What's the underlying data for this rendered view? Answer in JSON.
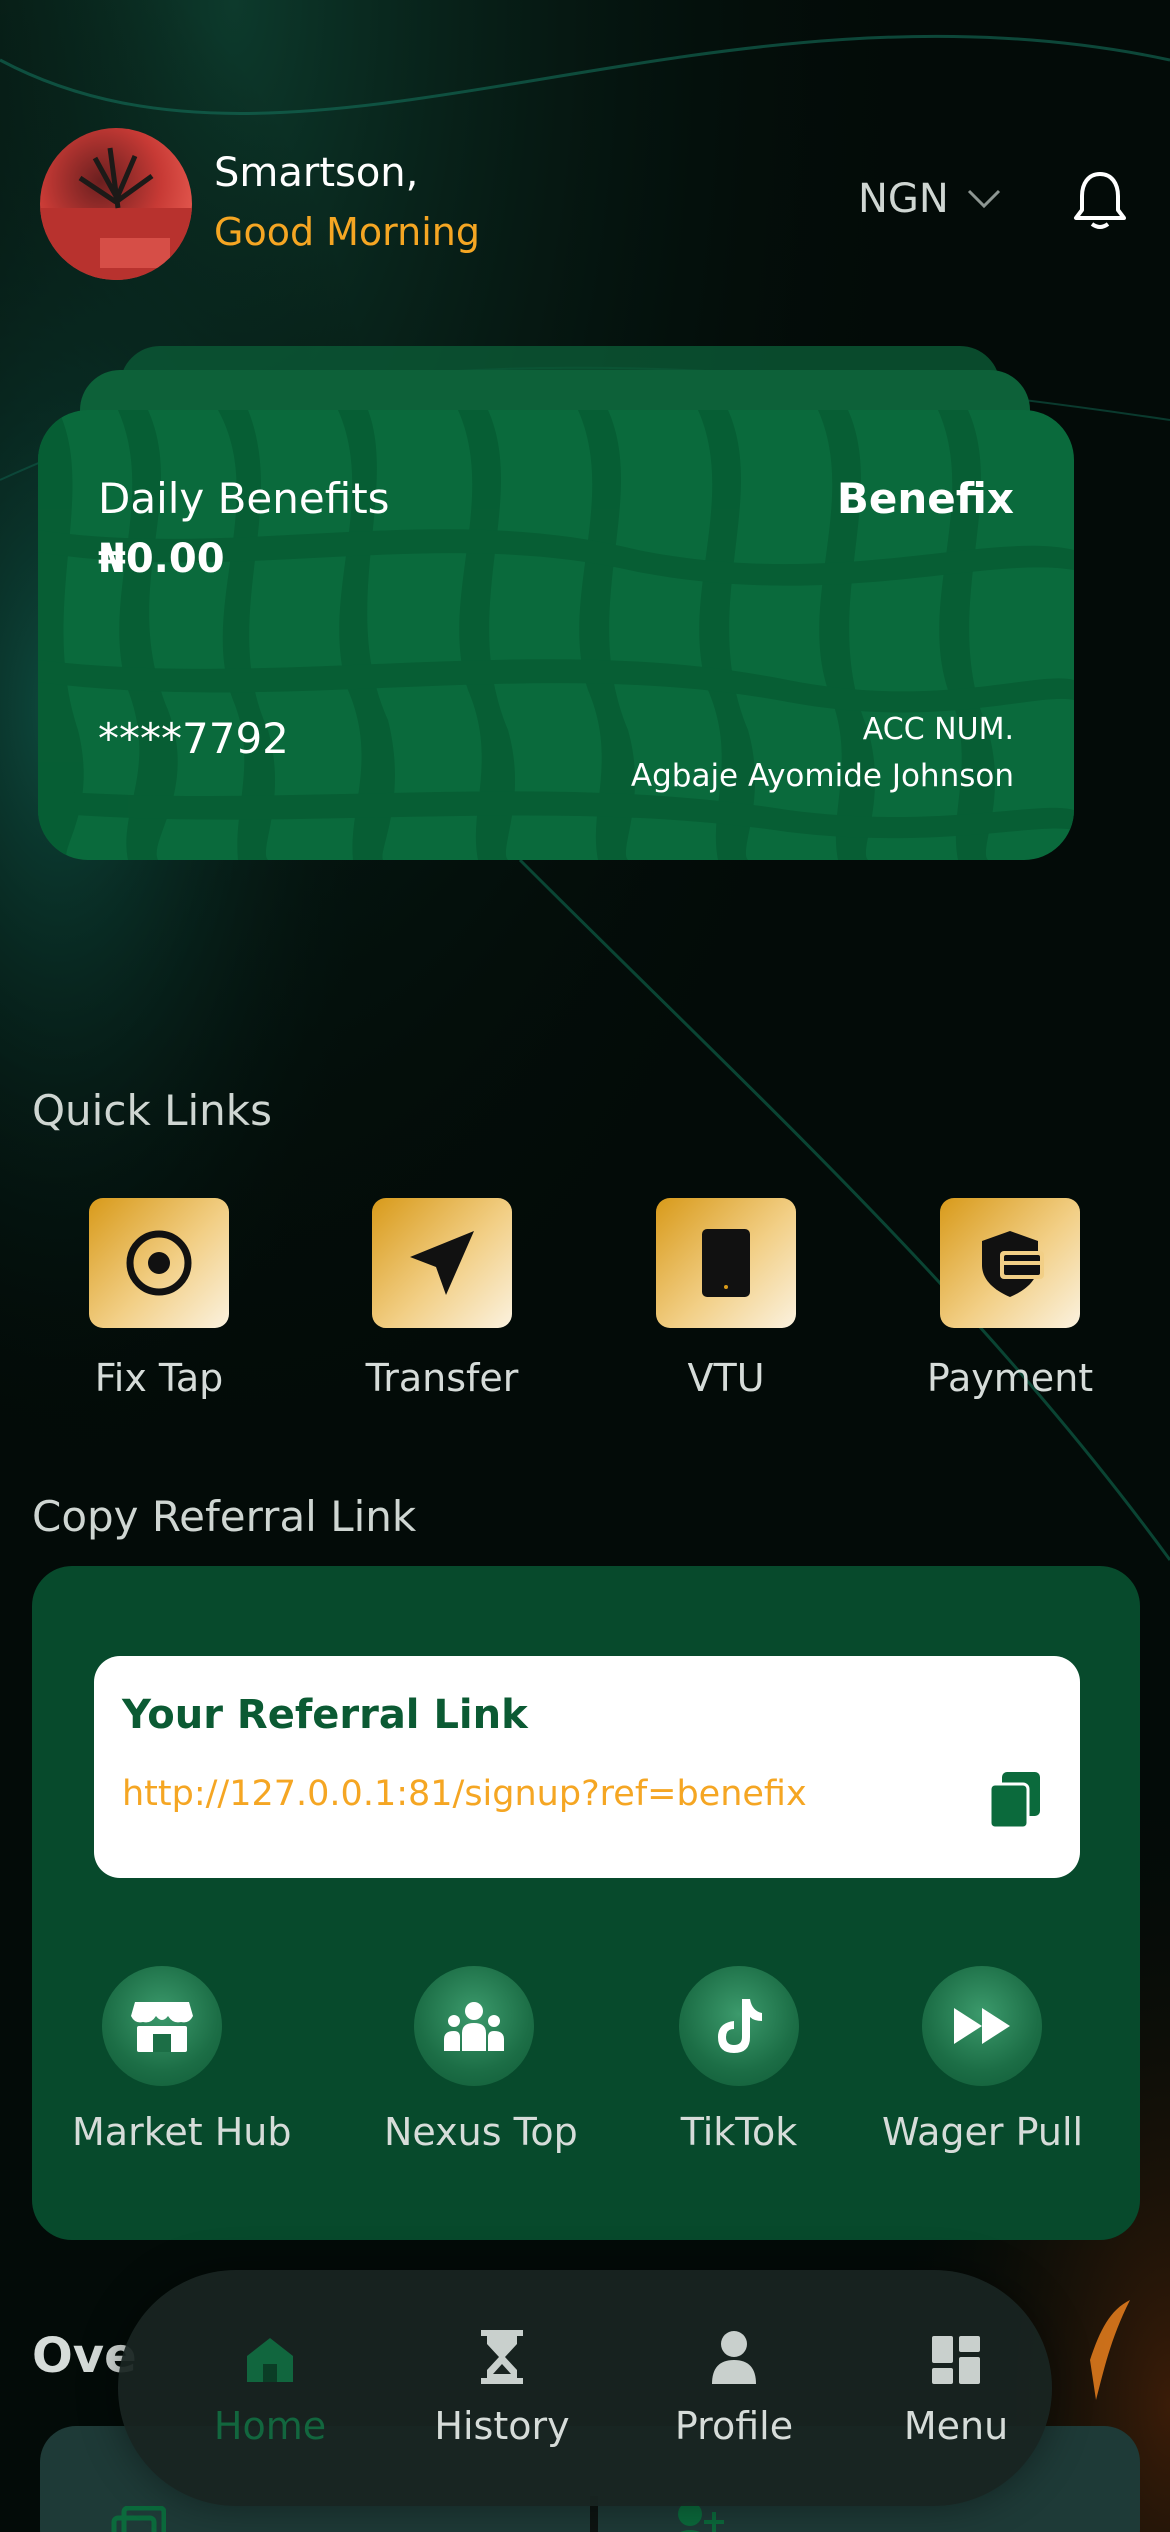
{
  "header": {
    "name": "Smartson,",
    "greeting": "Good Morning",
    "currency": "NGN"
  },
  "card": {
    "label": "Daily Benefits",
    "amount": "₦0.00",
    "brand": "Benefix",
    "masked_account": "****7792",
    "account_label": "ACC NUM.",
    "account_name": "Agbaje Ayomide Johnson"
  },
  "quick_links": {
    "title": "Quick Links",
    "items": [
      {
        "label": "Fix Tap",
        "icon": "target-icon"
      },
      {
        "label": "Transfer",
        "icon": "send-icon"
      },
      {
        "label": "VTU",
        "icon": "phone-icon"
      },
      {
        "label": "Payment",
        "icon": "shield-card-icon"
      }
    ]
  },
  "referral": {
    "title": "Copy Referral Link",
    "box_title": "Your Referral Link",
    "link": "http://127.0.0.1:81/signup?ref=benefix",
    "links": [
      {
        "label": "Market Hub",
        "icon": "store-icon"
      },
      {
        "label": "Nexus Top",
        "icon": "group-icon"
      },
      {
        "label": "TikTok",
        "icon": "tiktok-icon"
      },
      {
        "label": "Wager Pull",
        "icon": "fast-forward-icon"
      }
    ]
  },
  "overview": {
    "title": "Ove"
  },
  "nav": {
    "items": [
      {
        "label": "Home",
        "icon": "home-icon",
        "active": true
      },
      {
        "label": "History",
        "icon": "hourglass-icon",
        "active": false
      },
      {
        "label": "Profile",
        "icon": "person-icon",
        "active": false
      },
      {
        "label": "Menu",
        "icon": "dashboard-icon",
        "active": false
      }
    ]
  },
  "colors": {
    "accent": "#f5a623",
    "brand_green": "#0a6a3c",
    "panel_green": "#074a2c",
    "background": "#030b08"
  }
}
